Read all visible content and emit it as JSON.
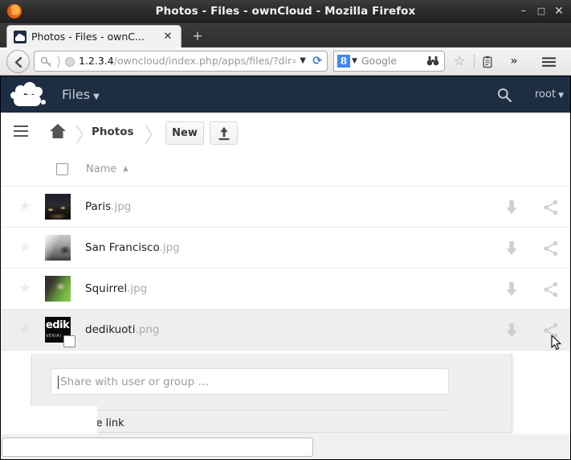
{
  "window": {
    "title": "Photos - Files - ownCloud - Mozilla Firefox",
    "minimize_label": "–",
    "maximize_label": "□",
    "close_label": "✕"
  },
  "browser": {
    "tab": {
      "label": "Photos - Files - ownC...",
      "close_label": "✕",
      "favicon": "owncloud-favicon"
    },
    "new_tab_label": "+",
    "url": {
      "host": "1.2.3.4",
      "path": "/owncloud/index.php/apps/files/?dir=",
      "dropdown_label": "▼",
      "reload_label": "⟳"
    },
    "search": {
      "engine_label": "8",
      "engine_dropdown": "▼",
      "placeholder": "Google"
    },
    "icons": {
      "star": "☆",
      "clipboard": "clipboard-icon",
      "overflow": "»",
      "menu": "menu-icon"
    }
  },
  "owncloud": {
    "app_name": "Files",
    "app_caret": "▼",
    "user": "root",
    "user_caret": "▼",
    "search_icon": "search-icon",
    "logo": "owncloud-logo"
  },
  "controls": {
    "menu_icon": "hamburger-icon",
    "home_icon": "home-icon",
    "separator": "〉",
    "breadcrumb_current": "Photos",
    "new_button": "New",
    "upload_button": "upload-icon"
  },
  "filelist": {
    "header": {
      "select_all_label": "",
      "name_column": "Name",
      "sort_indicator": "▲"
    },
    "rows": [
      {
        "name": "Paris",
        "extension": ".jpg",
        "thumb": "th-paris",
        "selected": false,
        "favorite": false,
        "download_label": "download-icon",
        "share_label": "share-icon"
      },
      {
        "name": "San Francisco",
        "extension": ".jpg",
        "thumb": "th-sf",
        "selected": false,
        "favorite": false,
        "download_label": "download-icon",
        "share_label": "share-icon"
      },
      {
        "name": "Squirrel",
        "extension": ".jpg",
        "thumb": "th-squirrel",
        "selected": false,
        "favorite": false,
        "download_label": "download-icon",
        "share_label": "share-icon"
      },
      {
        "name": "dedikuoti",
        "extension": ".png",
        "thumb": "th-dedik",
        "thumb_text_main": "edik",
        "thumb_text_sub": "VERIAI",
        "selected": true,
        "favorite": false,
        "download_label": "download-icon",
        "share_label": "share-icon"
      }
    ]
  },
  "share_panel": {
    "input_placeholder": "Share with user or group …",
    "input_value": "",
    "share_link_label": "Share link",
    "share_link_checked": false
  },
  "colors": {
    "oc_header_bg": "#1d2d42",
    "oc_header_text": "#c8cdd4",
    "row_selected_bg": "#eeeeee",
    "panel_bg": "#efefef",
    "link_blue": "#4285f4"
  }
}
